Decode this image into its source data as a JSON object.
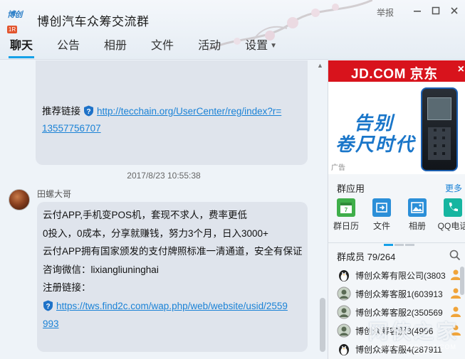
{
  "window": {
    "title": "博创汽车众筹交流群",
    "logo_text": "博创",
    "logo_badge": "1R",
    "report": "举报",
    "controls": [
      "minimize-icon",
      "maximize-icon",
      "close-icon"
    ]
  },
  "tabs": [
    {
      "label": "聊天",
      "active": true
    },
    {
      "label": "公告",
      "active": false
    },
    {
      "label": "相册",
      "active": false
    },
    {
      "label": "文件",
      "active": false
    },
    {
      "label": "活动",
      "active": false
    },
    {
      "label": "设置",
      "active": false,
      "has_dropdown": true
    }
  ],
  "chat": {
    "msg1": {
      "prefix": "推荐链接",
      "link": "http://tecchain.org/UserCenter/reg/index?r=",
      "link_cont": "13557756707"
    },
    "timestamp": "2017/8/23 10:55:38",
    "msg2": {
      "sender": "田螺大哥",
      "lines": [
        "云付APP,手机变POS机，套现不求人，费率更低",
        "0投入，0成本，分享就赚钱，努力3个月，日入3000+",
        "云付APP拥有国家颁发的支付牌照标准一清通道，安全有保证",
        "咨询微信：lixiangliuninghai",
        "注册链接："
      ],
      "link": "https://tws.find2c.com/wap.php/web/website/usid/2559",
      "link_cont": "993"
    }
  },
  "ad": {
    "brand": "JD.COM 京东",
    "slogan1": "告别",
    "slogan2": "卷尺时代",
    "label": "广告",
    "close": "×"
  },
  "apps": {
    "title": "群应用",
    "more": "更多",
    "items": [
      {
        "label": "群日历",
        "icon": "calendar-icon",
        "color": "#3fae4a"
      },
      {
        "label": "文件",
        "icon": "file-icon",
        "color": "#2b8fd8"
      },
      {
        "label": "相册",
        "icon": "photo-icon",
        "color": "#2b8fd8"
      },
      {
        "label": "QQ电话",
        "icon": "phone-icon",
        "color": "#16b5a0"
      }
    ]
  },
  "members": {
    "title": "群成员 79/264",
    "list": [
      {
        "name": "博创众筹有限公司(3803"
      },
      {
        "name": "博创众筹客服1(603913"
      },
      {
        "name": "博创众筹客服2(350569"
      },
      {
        "name": "博创众筹客服3(4996"
      },
      {
        "name": "博创众筹客服4(287911"
      }
    ]
  },
  "watermark": {
    "main": "网侠之家",
    "sub": "WWW.WEB-ZUZ.COM"
  },
  "colors": {
    "accent": "#16a1e8",
    "link": "#1a82d6",
    "jd_red": "#d8131c",
    "bubble": "#dfe4ec"
  }
}
